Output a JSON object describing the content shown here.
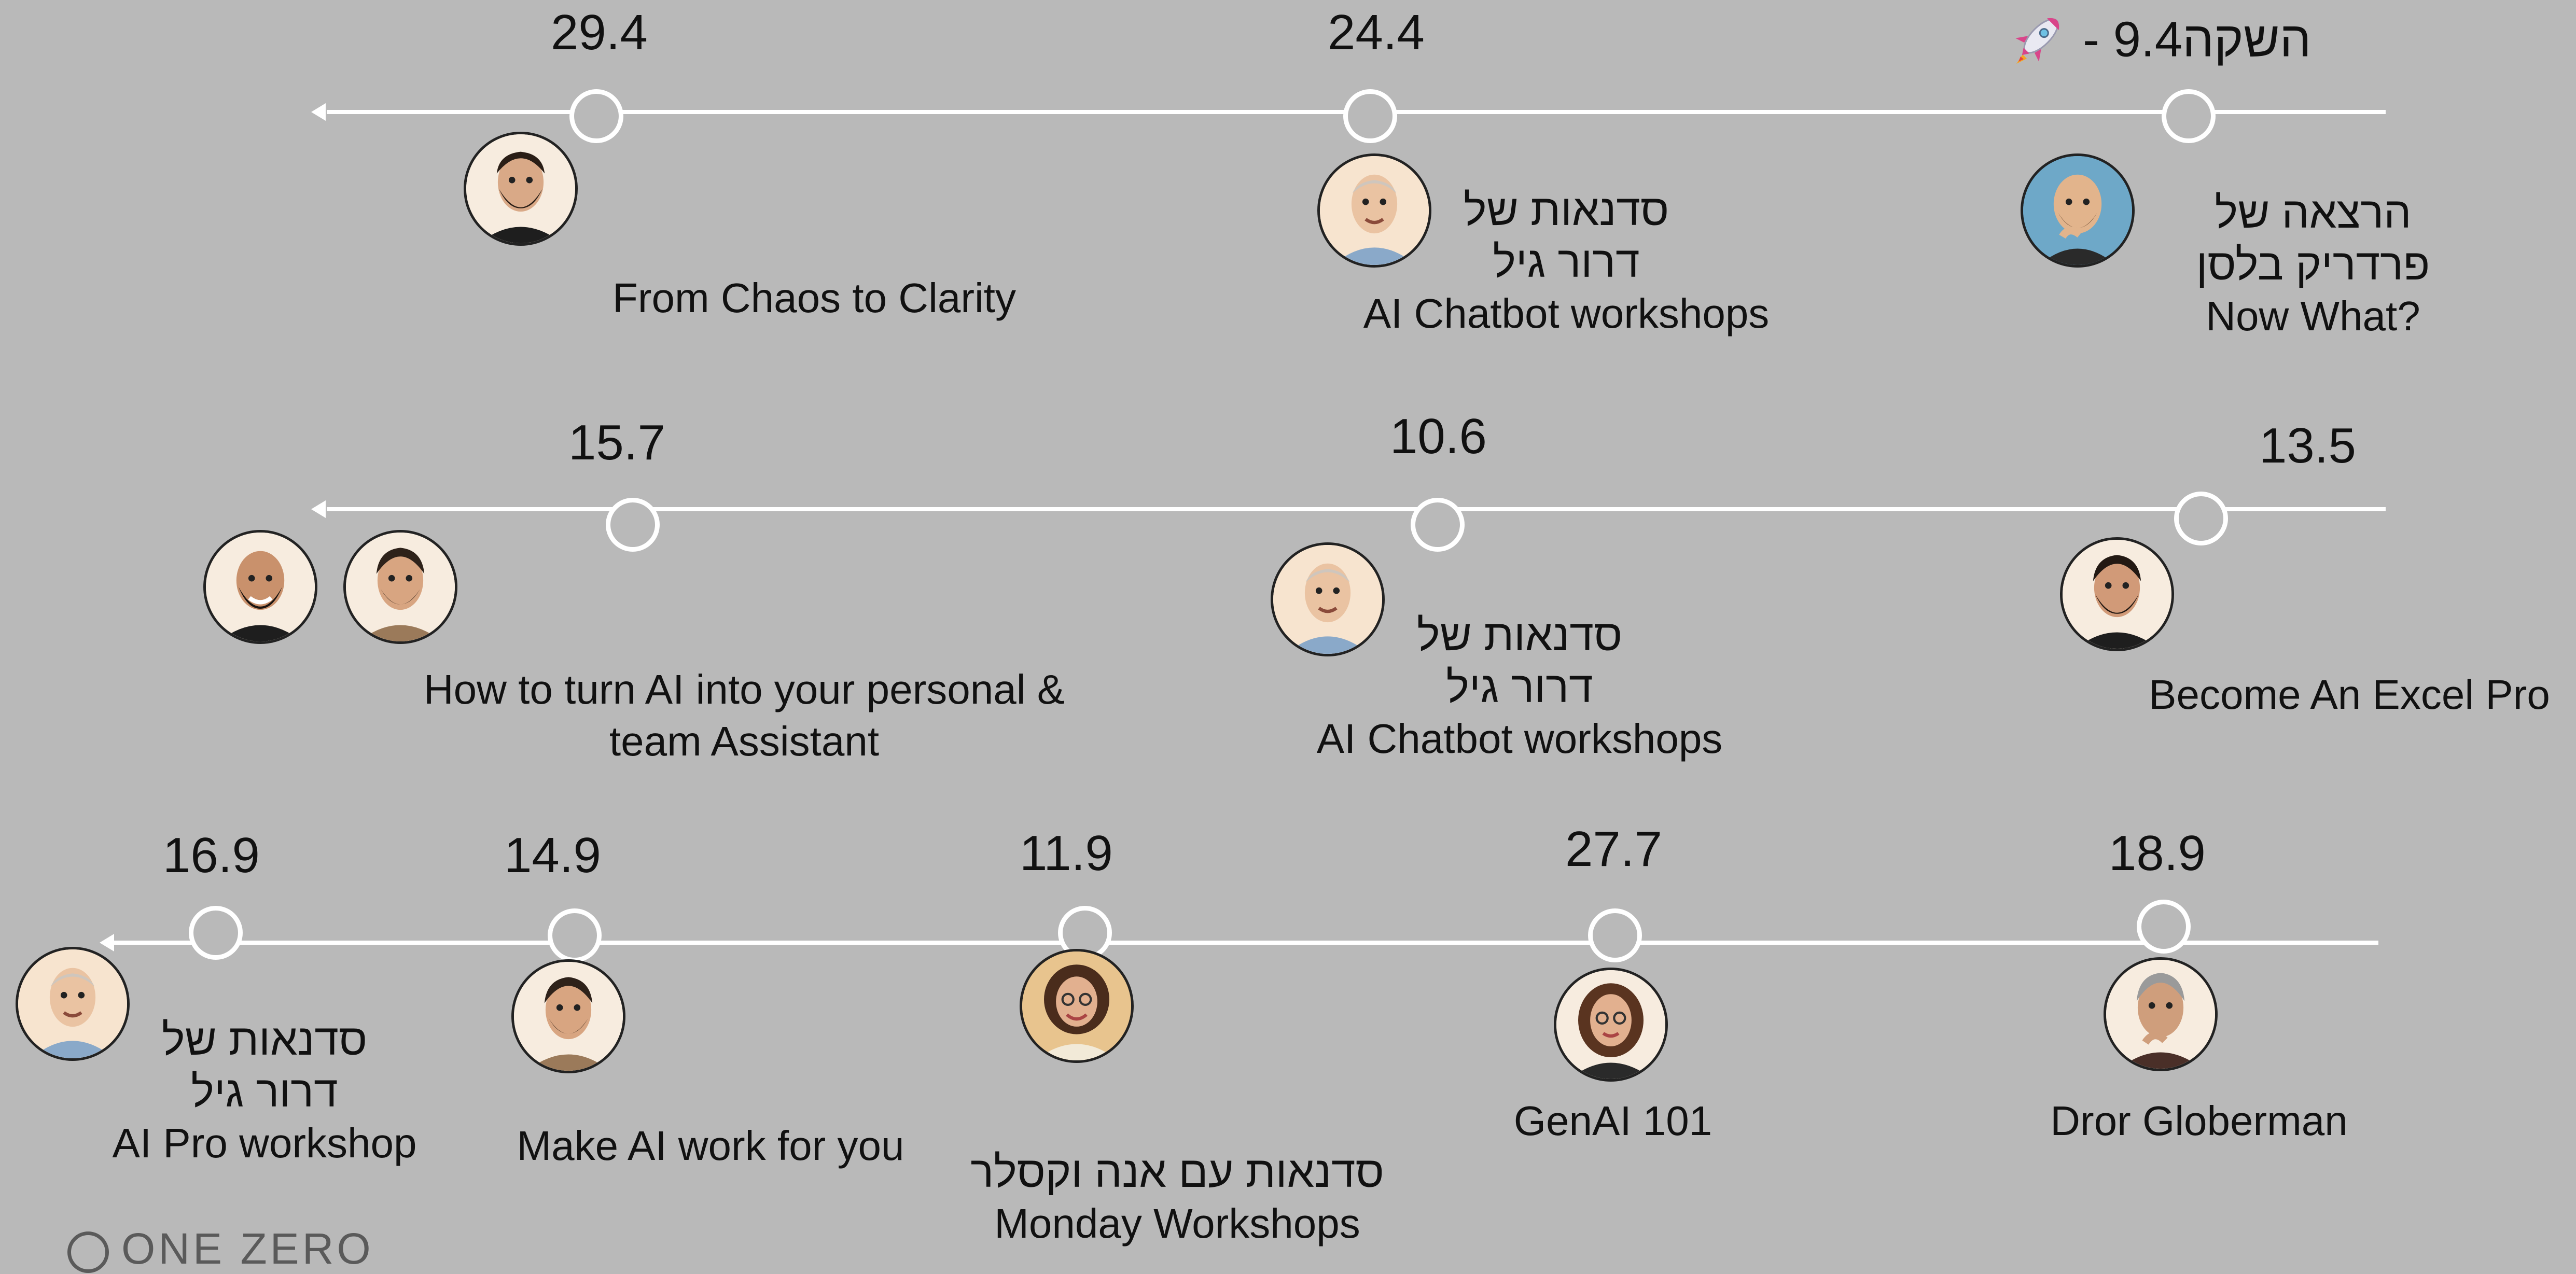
{
  "brand": {
    "logo_text": "ONE ZERO"
  },
  "colors": {
    "background": "#b9b9b9",
    "timeline": "#ffffff",
    "text": "#111111"
  },
  "rows": [
    {
      "events": [
        {
          "date": "- 9.4",
          "date_suffix": "השקה",
          "icon": "rocket-icon",
          "title_he_1": "הרצאה של",
          "title_he_2": "פרדריק בלסן",
          "title_en": "Now What?"
        },
        {
          "date": "24.4",
          "title_he_1": "סדנאות של",
          "title_he_2": "דרור גיל",
          "title_en": "AI Chatbot workshops"
        },
        {
          "date": "29.4",
          "title_en": "From Chaos to Clarity"
        }
      ]
    },
    {
      "events": [
        {
          "date": "13.5",
          "title_en": "Become An Excel Pro"
        },
        {
          "date": "10.6",
          "title_he_1": "סדנאות של",
          "title_he_2": "דרור גיל",
          "title_en": "AI Chatbot workshops"
        },
        {
          "date": "15.7",
          "title_en_1": "How to turn AI into your personal &",
          "title_en_2": "team Assistant"
        }
      ]
    },
    {
      "events": [
        {
          "date": "18.9",
          "title_en": "Dror Globerman"
        },
        {
          "date": "27.7",
          "title_en": "GenAI 101"
        },
        {
          "date": "11.9",
          "title_he_1": "סדנאות עם אנה וקסלר",
          "title_en": "Monday Workshops"
        },
        {
          "date": "14.9",
          "title_en": "Make AI work for you"
        },
        {
          "date": "16.9",
          "title_he_1": "סדנאות של",
          "title_he_2": "דרור גיל",
          "title_en": "AI Pro workshop"
        }
      ]
    }
  ]
}
